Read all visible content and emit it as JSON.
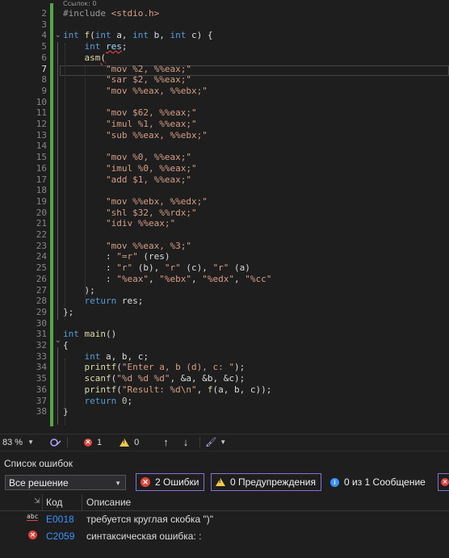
{
  "editor": {
    "ref_hint": "Ссылок: 0",
    "current_line": 7,
    "lines": [
      {
        "n": "2",
        "html": "<span class=\"pp\">#include</span> <span class=\"str\">&lt;stdio.h&gt;</span>"
      },
      {
        "n": "3",
        "html": ""
      },
      {
        "n": "4",
        "html": "<span class=\"kw\">int</span> <span class=\"fn\">f</span>(<span class=\"kw\">int</span> a, <span class=\"kw\">int</span> b, <span class=\"kw\">int</span> c) {"
      },
      {
        "n": "5",
        "html": "    <span class=\"kw\">int</span> <span class=\"var squig\">res</span>;"
      },
      {
        "n": "6",
        "html": "    <span class=\"fn\">asm</span><span class=\"squig\">(</span>"
      },
      {
        "n": "7",
        "html": "        <span class=\"str\">\"mov %2, %%eax;\"</span>"
      },
      {
        "n": "8",
        "html": "        <span class=\"str\">\"sar $2, %%eax;\"</span>"
      },
      {
        "n": "9",
        "html": "        <span class=\"str\">\"mov %%eax, %%ebx;\"</span>"
      },
      {
        "n": "10",
        "html": ""
      },
      {
        "n": "11",
        "html": "        <span class=\"str\">\"mov $62, %%eax;\"</span>"
      },
      {
        "n": "12",
        "html": "        <span class=\"str\">\"imul %1, %%eax;\"</span>"
      },
      {
        "n": "13",
        "html": "        <span class=\"str\">\"sub %%eax, %%ebx;\"</span>"
      },
      {
        "n": "14",
        "html": ""
      },
      {
        "n": "15",
        "html": "        <span class=\"str\">\"mov %0, %%eax;\"</span>"
      },
      {
        "n": "16",
        "html": "        <span class=\"str\">\"imul %0, %%eax;\"</span>"
      },
      {
        "n": "17",
        "html": "        <span class=\"str\">\"add $1, %%eax;\"</span>"
      },
      {
        "n": "18",
        "html": ""
      },
      {
        "n": "19",
        "html": "        <span class=\"str\">\"mov %%ebx, %%edx;\"</span>"
      },
      {
        "n": "20",
        "html": "        <span class=\"str\">\"shl $32, %%rdx;\"</span>"
      },
      {
        "n": "21",
        "html": "        <span class=\"str\">\"idiv %%eax;\"</span>"
      },
      {
        "n": "22",
        "html": ""
      },
      {
        "n": "23",
        "html": "        <span class=\"str\">\"mov %%eax, %3;\"</span>"
      },
      {
        "n": "24",
        "html": "        : <span class=\"str\">\"=r\"</span> (res)"
      },
      {
        "n": "25",
        "html": "        : <span class=\"str\">\"r\"</span> (b), <span class=\"str\">\"r\"</span> (c), <span class=\"str\">\"r\"</span> (a)"
      },
      {
        "n": "26",
        "html": "        : <span class=\"str\">\"%eax\"</span>, <span class=\"str\">\"%ebx\"</span>, <span class=\"str\">\"%edx\"</span>, <span class=\"str\">\"%cc\"</span>"
      },
      {
        "n": "27",
        "html": "    );"
      },
      {
        "n": "28",
        "html": "    <span class=\"kw\">return</span> res;"
      },
      {
        "n": "29",
        "html": "};"
      },
      {
        "n": "30",
        "html": ""
      },
      {
        "n": "31",
        "html": "<span class=\"kw\">int</span> <span class=\"fn\">main</span>()"
      },
      {
        "n": "32",
        "html": "{"
      },
      {
        "n": "33",
        "html": "    <span class=\"kw\">int</span> a, b, c;"
      },
      {
        "n": "34",
        "html": "    <span class=\"fn\">printf</span>(<span class=\"str\">\"Enter a, b (d), c: \"</span>);"
      },
      {
        "n": "35",
        "html": "    <span class=\"fn\">scanf</span>(<span class=\"str\">\"%d %d %d\"</span>, &amp;a, &amp;b, &amp;c);"
      },
      {
        "n": "36",
        "html": "    <span class=\"fn\">printf</span>(<span class=\"str\">\"Result: %d\\n\"</span>, <span class=\"fn\">f</span>(a, b, c));"
      },
      {
        "n": "37",
        "html": "    <span class=\"kw\">return</span> <span class=\"num\">0</span>;"
      },
      {
        "n": "38",
        "html": "}"
      }
    ]
  },
  "status": {
    "zoom": "83 %",
    "errors": "1",
    "warnings": "0"
  },
  "error_list": {
    "title": "Список ошибок",
    "scope": "Все решение",
    "errors_btn": "2 Ошибки",
    "warnings_btn": "0 Предупреждения",
    "messages_btn": "0 из 1 Сообщение",
    "col_code": "Код",
    "col_desc": "Описание",
    "rows": [
      {
        "icon": "abc-icon",
        "code": "E0018",
        "desc": "требуется круглая скобка \")\""
      },
      {
        "icon": "error-icon",
        "code": "C2059",
        "desc": "синтаксическая ошибка: :"
      }
    ]
  },
  "colors": {
    "accent": "#55a649",
    "error": "#e0443e",
    "warning": "#f2c94c",
    "link": "#3794ff"
  }
}
